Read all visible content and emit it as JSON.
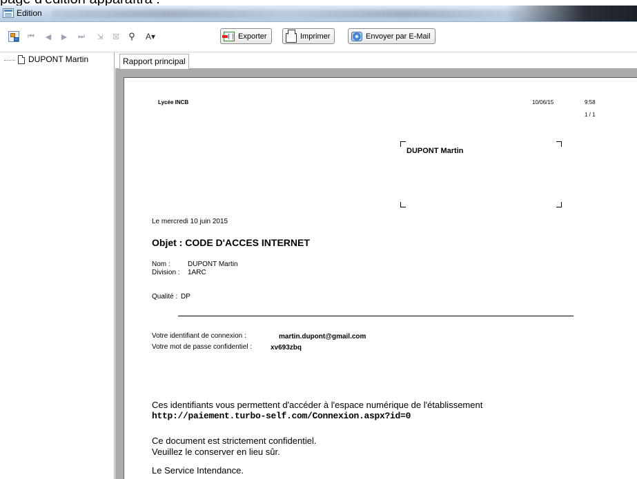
{
  "caption_fragment": "page d'édition apparaîtra :",
  "window": {
    "title": "Edition"
  },
  "toolbar": {
    "export_label": "Exporter",
    "print_label": "Imprimer",
    "email_label": "Envoyer par E-Mail",
    "icons": [
      "tree-toggle-icon",
      "first-page-icon",
      "previous-page-icon",
      "next-page-icon",
      "last-page-icon",
      "export-page-icon",
      "close-icon",
      "find-icon",
      "zoom-icon"
    ]
  },
  "tree": {
    "items": [
      {
        "label": "DUPONT Martin"
      }
    ]
  },
  "tabs": [
    {
      "label": "Rapport principal",
      "active": true
    }
  ],
  "report": {
    "school": "Lycée INCB",
    "date": "10/06/15",
    "time": "9:58",
    "page": "1 / 1",
    "recipient": "DUPONT Martin",
    "date_line": "Le  mercredi 10 juin 2015",
    "subject": "Objet : CODE D'ACCES INTERNET",
    "nom_label": "Nom :",
    "nom_value": "DUPONT Martin",
    "division_label": "Division :",
    "division_value": "1ARC",
    "qualite_label": "Qualité :",
    "qualite_value": "DP",
    "login_label": "Votre identifiant de connexion :",
    "login_value": "martin.dupont@gmail.com",
    "password_label": "Votre mot de passe confidentiel :",
    "password_value": "xv693zbq",
    "info_line": "Ces identifiants vous permettent d'accéder à l'espace numérique de l'établissement",
    "url": "http://paiement.turbo-self.com/Connexion.aspx?id=0",
    "confidential_1": "Ce document est strictement confidentiel.",
    "confidential_2": "Veuillez le conserver en lieu sûr.",
    "signature": "Le Service Intendance."
  }
}
